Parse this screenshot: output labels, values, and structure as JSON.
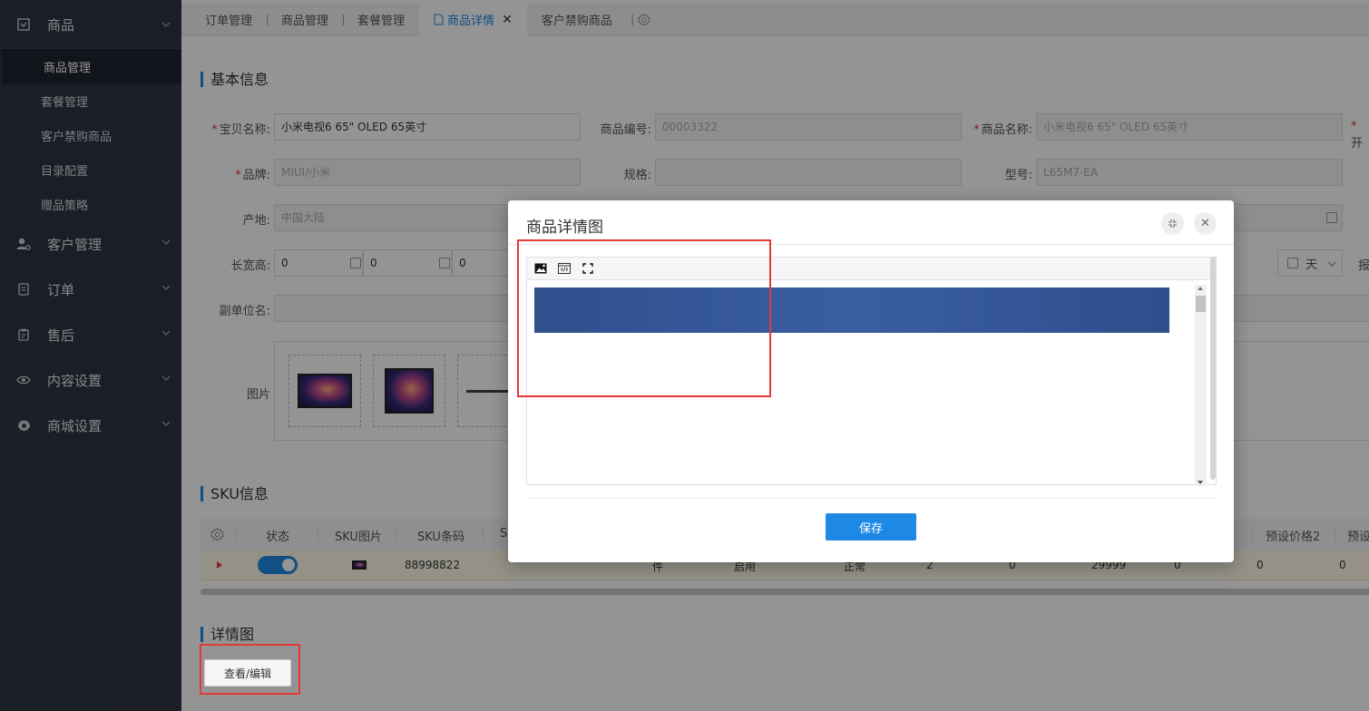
{
  "sidebar": {
    "groups": [
      {
        "label": "商品",
        "icon": "product-icon"
      },
      {
        "label": "客户管理",
        "icon": "user-icon"
      },
      {
        "label": "订单",
        "icon": "order-icon"
      },
      {
        "label": "售后",
        "icon": "aftersale-icon"
      },
      {
        "label": "内容设置",
        "icon": "eye-icon"
      },
      {
        "label": "商城设置",
        "icon": "gear-icon"
      }
    ],
    "sub_items": [
      "商品管理",
      "套餐管理",
      "客户禁购商品",
      "目录配置",
      "赠品策略"
    ]
  },
  "tabs": [
    "订单管理",
    "商品管理",
    "套餐管理",
    "商品详情",
    "客户禁购商品"
  ],
  "basic": {
    "title": "基本信息",
    "name_label": "宝贝名称:",
    "name_value": "小米电视6 65\" OLED 65英寸",
    "code_label": "商品编号:",
    "code_value": "00003322",
    "goods_name_label": "商品名称:",
    "goods_name_value": "小米电视6 65\" OLED 65英寸",
    "extra_label": "开",
    "brand_label": "品牌:",
    "brand_value": "MIUI/小米",
    "spec_label": "规格:",
    "model_label": "型号:",
    "model_value": "L65M7-EA",
    "origin_label": "产地:",
    "origin_value": "中国大陆",
    "size_label": "长宽高:",
    "size_values": [
      "0",
      "0",
      "0"
    ],
    "day_unit": "天",
    "report_label": "报",
    "sub_unit_label": "副单位名:",
    "image_label": "图片"
  },
  "sku": {
    "title": "SKU信息",
    "headers": [
      "状态",
      "SKU图片",
      "SKU条码",
      "S",
      "预设价格2",
      "预设"
    ],
    "row": {
      "barcode": "88998822",
      "unit": "件",
      "enable": "启用",
      "state": "正常",
      "v1": "2",
      "v2": "0",
      "price": "29999",
      "v3": "0",
      "v4": "0",
      "v5": "0"
    }
  },
  "detail": {
    "title": "详情图",
    "edit_button": "查看/编辑"
  },
  "modal": {
    "title": "商品详情图",
    "save_button": "保存"
  },
  "colors": {
    "accent": "#1e88e5",
    "sidebar_bg": "#2f3542",
    "highlight_box": "#e53935"
  }
}
